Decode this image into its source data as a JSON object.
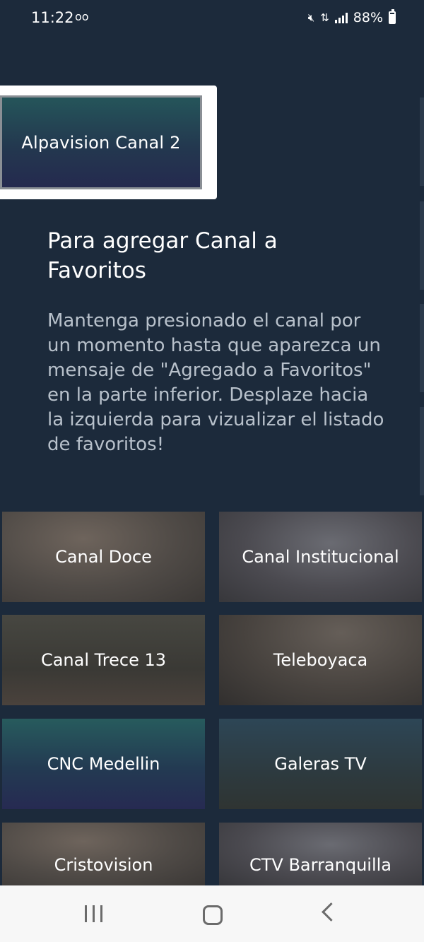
{
  "status_bar": {
    "time": "11:22",
    "voicemail_icon": "oo",
    "battery": "88%",
    "battery_level": 0.88
  },
  "featured": {
    "label": "Alpavision Canal 2"
  },
  "info": {
    "title": "Para agregar Canal a Favoritos",
    "body": "Mantenga presionado el canal por un momento hasta que aparezca un mensaje de \"Agregado a Favoritos\" en la parte inferior. Desplaze hacia la izquierda para vizualizar el listado de favoritos!"
  },
  "channels": [
    {
      "label": "Canal Doce"
    },
    {
      "label": "Canal Institucional"
    },
    {
      "label": "Canal Trece 13"
    },
    {
      "label": "Teleboyaca"
    },
    {
      "label": "CNC Medellin"
    },
    {
      "label": "Galeras TV"
    },
    {
      "label": "Cristovision"
    },
    {
      "label": "CTV Barranquilla"
    }
  ],
  "icons": {
    "mute": "mute-icon",
    "data": "data-transfer-icon",
    "signal": "signal-icon",
    "battery": "battery-icon",
    "recent": "recent-apps-icon",
    "home": "home-icon",
    "back": "back-icon"
  }
}
